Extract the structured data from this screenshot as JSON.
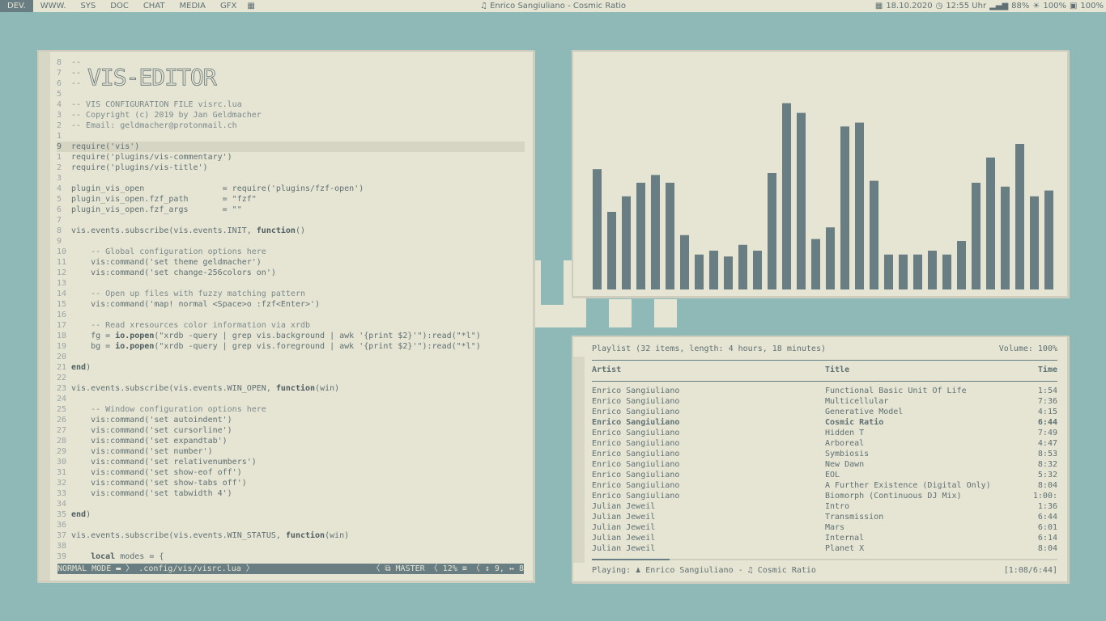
{
  "topbar": {
    "tags": [
      {
        "label": "DEV.",
        "active": true
      },
      {
        "label": "WWW.",
        "active": false
      },
      {
        "label": "SYS",
        "active": false
      },
      {
        "label": "DOC",
        "active": false
      },
      {
        "label": "CHAT",
        "active": false
      },
      {
        "label": "MEDIA",
        "active": false
      },
      {
        "label": "GFX",
        "active": false
      }
    ],
    "layout_icon": "tile-layout-icon",
    "now_playing": "♫ Enrico Sangiuliano - Cosmic Ratio",
    "status": {
      "date": "18.10.2020",
      "time": "12:55 Uhr",
      "wifi": "88%",
      "brightness": "100%",
      "battery": "100%"
    }
  },
  "editor": {
    "logo": "VIS-EDITOR",
    "lines": [
      {
        "n": "8",
        "t": "--"
      },
      {
        "n": "7",
        "t": "--"
      },
      {
        "n": "6",
        "t": "--"
      },
      {
        "n": "5",
        "t": ""
      },
      {
        "n": "4",
        "t": "-- VIS CONFIGURATION FILE visrc.lua"
      },
      {
        "n": "3",
        "t": "-- Copyright (c) 2019 by Jan Geldmacher"
      },
      {
        "n": "2",
        "t": "-- Email: geldmacher@protonmail.ch"
      },
      {
        "n": "1",
        "t": ""
      },
      {
        "n": "9",
        "t": "require('vis')",
        "current": true
      },
      {
        "n": "1",
        "t": "require('plugins/vis-commentary')"
      },
      {
        "n": "2",
        "t": "require('plugins/vis-title')"
      },
      {
        "n": "3",
        "t": ""
      },
      {
        "n": "4",
        "t": "plugin_vis_open                = require('plugins/fzf-open')"
      },
      {
        "n": "5",
        "t": "plugin_vis_open.fzf_path       = \"fzf\""
      },
      {
        "n": "6",
        "t": "plugin_vis_open.fzf_args       = \"\""
      },
      {
        "n": "7",
        "t": ""
      },
      {
        "n": "8",
        "t": "vis.events.subscribe(vis.events.INIT, function()"
      },
      {
        "n": "9",
        "t": ""
      },
      {
        "n": "10",
        "t": "    -- Global configuration options here"
      },
      {
        "n": "11",
        "t": "    vis:command('set theme geldmacher')"
      },
      {
        "n": "12",
        "t": "    vis:command('set change-256colors on')"
      },
      {
        "n": "13",
        "t": ""
      },
      {
        "n": "14",
        "t": "    -- Open up files with fuzzy matching pattern"
      },
      {
        "n": "15",
        "t": "    vis:command('map! normal <Space>o :fzf<Enter>')"
      },
      {
        "n": "16",
        "t": ""
      },
      {
        "n": "17",
        "t": "    -- Read xresources color information via xrdb"
      },
      {
        "n": "18",
        "t": "    fg = io.popen(\"xrdb -query | grep vis.background | awk '{print $2}'\"):read(\"*l\")"
      },
      {
        "n": "19",
        "t": "    bg = io.popen(\"xrdb -query | grep vis.foreground | awk '{print $2}'\"):read(\"*l\")"
      },
      {
        "n": "20",
        "t": ""
      },
      {
        "n": "21",
        "t": "end)"
      },
      {
        "n": "22",
        "t": ""
      },
      {
        "n": "23",
        "t": "vis.events.subscribe(vis.events.WIN_OPEN, function(win)"
      },
      {
        "n": "24",
        "t": ""
      },
      {
        "n": "25",
        "t": "    -- Window configuration options here"
      },
      {
        "n": "26",
        "t": "    vis:command('set autoindent')"
      },
      {
        "n": "27",
        "t": "    vis:command('set cursorline')"
      },
      {
        "n": "28",
        "t": "    vis:command('set expandtab')"
      },
      {
        "n": "29",
        "t": "    vis:command('set number')"
      },
      {
        "n": "30",
        "t": "    vis:command('set relativenumbers')"
      },
      {
        "n": "31",
        "t": "    vis:command('set show-eof off')"
      },
      {
        "n": "32",
        "t": "    vis:command('set show-tabs off')"
      },
      {
        "n": "33",
        "t": "    vis:command('set tabwidth 4')"
      },
      {
        "n": "34",
        "t": ""
      },
      {
        "n": "35",
        "t": "end)"
      },
      {
        "n": "36",
        "t": ""
      },
      {
        "n": "37",
        "t": "vis.events.subscribe(vis.events.WIN_STATUS, function(win)"
      },
      {
        "n": "38",
        "t": ""
      },
      {
        "n": "39",
        "t": "    local modes = {"
      }
    ],
    "status": {
      "mode": "NORMAL MODE ▬ 〉 .config/vis/visrc.lua 〉",
      "right": "〈 ⧉ MASTER 〈 12% ≡ 〈 ↕ 9, ↔ 8"
    }
  },
  "visualizer": {
    "levels": [
      0.62,
      0.4,
      0.48,
      0.55,
      0.59,
      0.55,
      0.28,
      0.18,
      0.2,
      0.17,
      0.23,
      0.2,
      0.6,
      0.96,
      0.91,
      0.26,
      0.32,
      0.84,
      0.86,
      0.56,
      0.18,
      0.18,
      0.18,
      0.2,
      0.18,
      0.25,
      0.55,
      0.68,
      0.53,
      0.75,
      0.48,
      0.51
    ],
    "bar_color": "#687e82"
  },
  "playlist": {
    "header": "Playlist (32 items, length: 4 hours, 18 minutes)",
    "volume": "Volume: 100%",
    "columns": {
      "artist": "Artist",
      "title": "Title",
      "time": "Time"
    },
    "rows": [
      {
        "artist": "Enrico Sangiuliano",
        "title": "Functional Basic Unit Of Life",
        "time": "1:54"
      },
      {
        "artist": "Enrico Sangiuliano",
        "title": "Multicellular",
        "time": "7:36"
      },
      {
        "artist": "Enrico Sangiuliano",
        "title": "Generative Model",
        "time": "4:15"
      },
      {
        "artist": "Enrico Sangiuliano",
        "title": "Cosmic Ratio",
        "time": "6:44",
        "playing": true
      },
      {
        "artist": "Enrico Sangiuliano",
        "title": "Hidden T",
        "time": "7:49"
      },
      {
        "artist": "Enrico Sangiuliano",
        "title": "Arboreal",
        "time": "4:47"
      },
      {
        "artist": "Enrico Sangiuliano",
        "title": "Symbiosis",
        "time": "8:53"
      },
      {
        "artist": "Enrico Sangiuliano",
        "title": "New Dawn",
        "time": "8:32"
      },
      {
        "artist": "Enrico Sangiuliano",
        "title": "EOL",
        "time": "5:32"
      },
      {
        "artist": "Enrico Sangiuliano",
        "title": "A Further Existence (Digital Only)",
        "time": "8:04"
      },
      {
        "artist": "Enrico Sangiuliano",
        "title": "Biomorph (Continuous DJ Mix)",
        "time": "1:00:"
      },
      {
        "artist": "Julian Jeweil",
        "title": "Intro",
        "time": "1:36"
      },
      {
        "artist": "Julian Jeweil",
        "title": "Transmission",
        "time": "6:44"
      },
      {
        "artist": "Julian Jeweil",
        "title": "Mars",
        "time": "6:01"
      },
      {
        "artist": "Julian Jeweil",
        "title": "Internal",
        "time": "6:14"
      },
      {
        "artist": "Julian Jeweil",
        "title": "Planet X",
        "time": "8:04"
      }
    ],
    "progress": 0.167,
    "footer": {
      "playing": "Playing: ♟ Enrico Sangiuliano - ♫ Cosmic Ratio",
      "position": "[1:08/6:44]"
    }
  }
}
